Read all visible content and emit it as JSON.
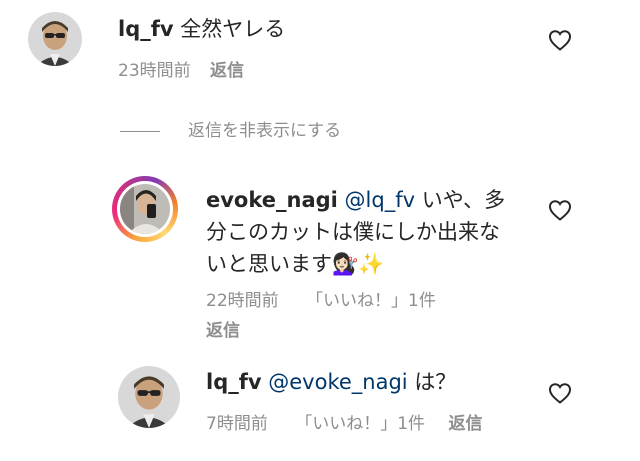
{
  "comments": [
    {
      "username": "lq_fv",
      "text": "全然ヤレる",
      "time": "23時間前",
      "reply_label": "返信"
    }
  ],
  "hide_replies_label": "返信を非表示にする",
  "replies": [
    {
      "username": "evoke_nagi",
      "mention": "@lq_fv",
      "text_line1": "いや、多",
      "text_line2": "分このカットは僕にしか出来な",
      "text_line3": "いと思います",
      "emoji": "💇🏻‍♀️✨",
      "time": "22時間前",
      "likes_label": "「いいね！」1件",
      "reply_label": "返信"
    },
    {
      "username": "lq_fv",
      "mention": "@evoke_nagi",
      "text": "は？",
      "time": "7時間前",
      "likes_label": "「いいね！」1件",
      "reply_label": "返信"
    }
  ],
  "icons": {
    "like": "heart-outline-icon"
  },
  "colors": {
    "text": "#262626",
    "meta": "#8e8e8e",
    "mention": "#00376b"
  }
}
